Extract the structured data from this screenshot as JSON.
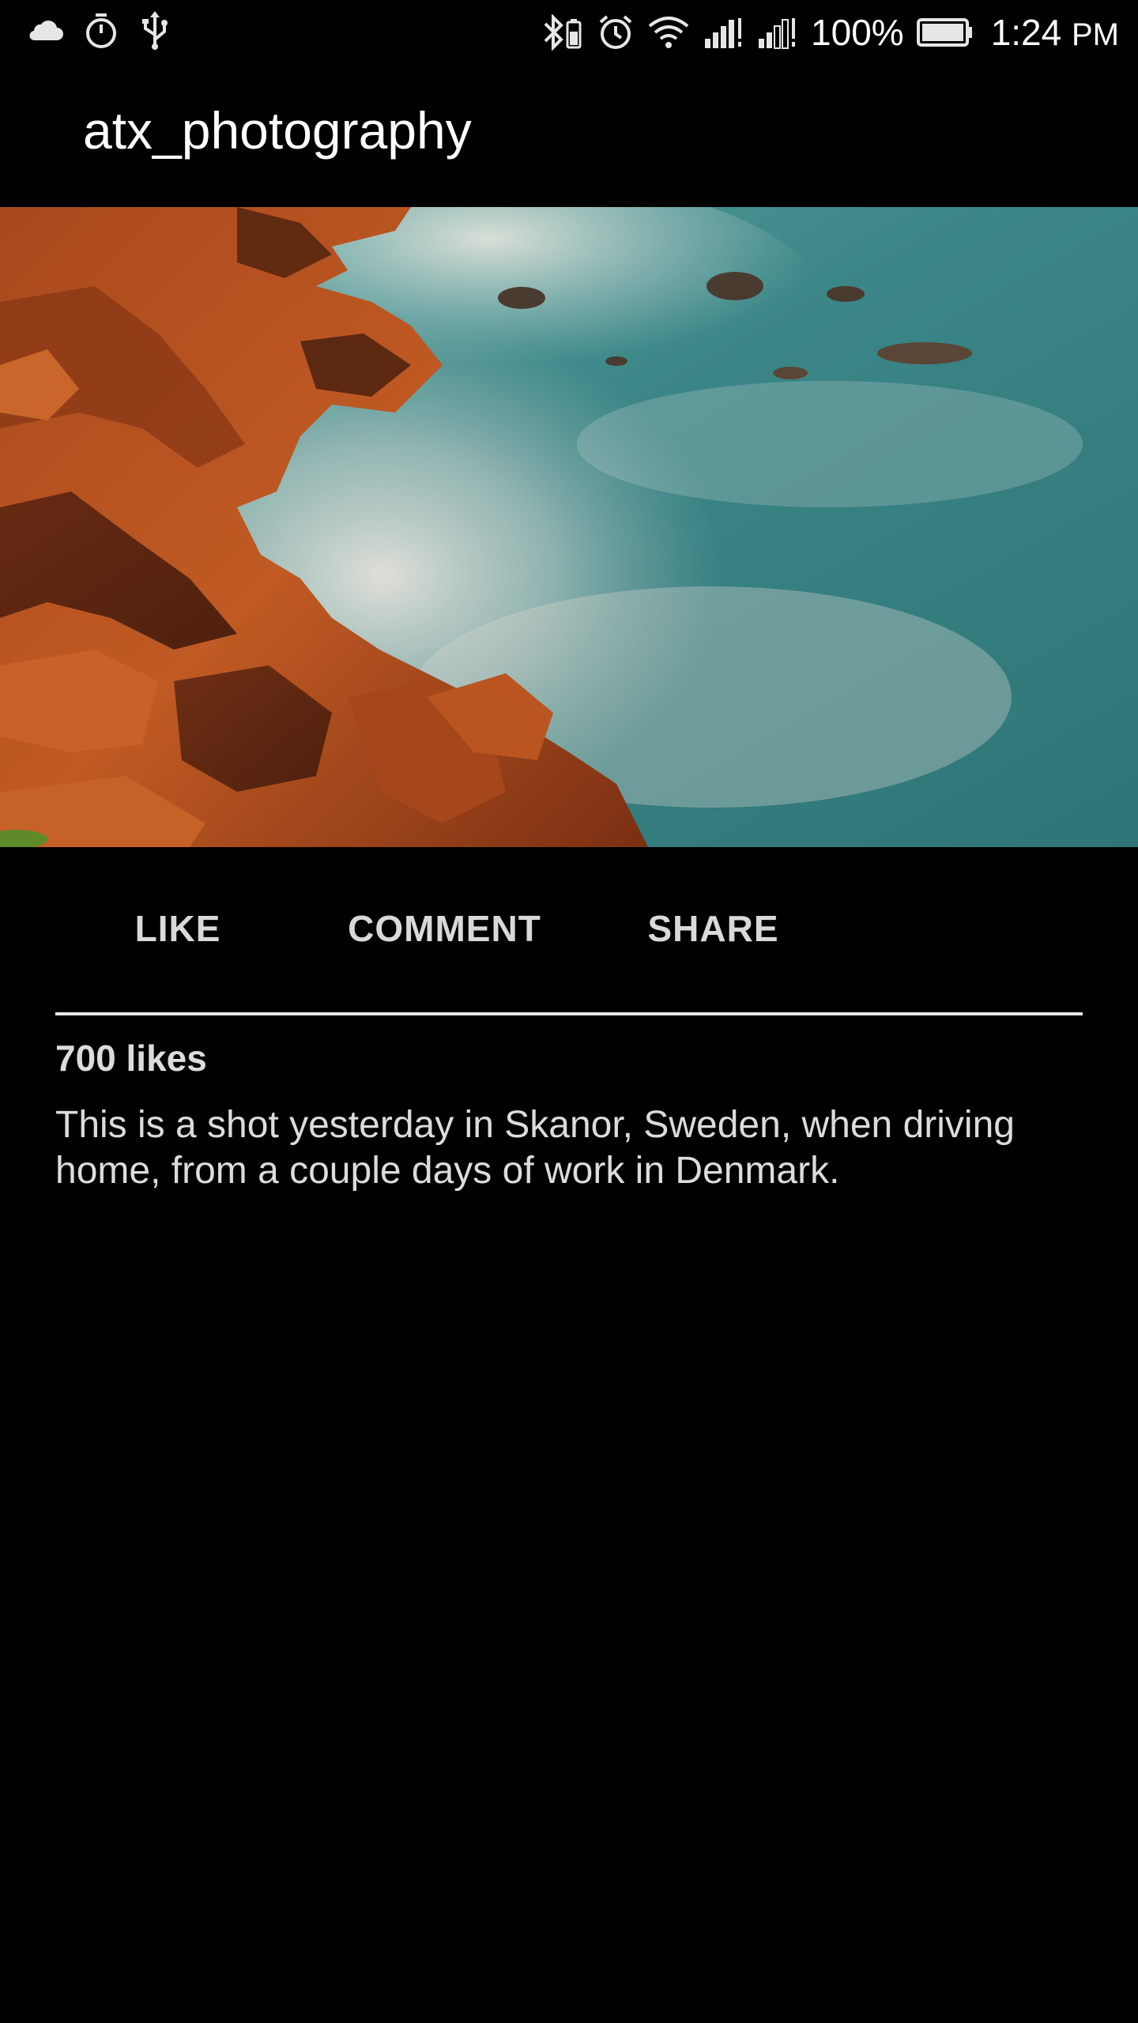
{
  "status_bar": {
    "left_icons": [
      "cloud-icon",
      "stopwatch-icon",
      "usb-icon"
    ],
    "right_icons": [
      "bluetooth-battery-icon",
      "alarm-icon",
      "wifi-icon",
      "signal-icon",
      "signal-icon-2",
      "battery-icon"
    ],
    "battery_percent": "100%",
    "time": "1:24",
    "ampm": "PM"
  },
  "app_bar": {
    "title": "atx_photography"
  },
  "post": {
    "photo_icon": "coastal-rocks-photo",
    "actions": {
      "like": "LIKE",
      "comment": "COMMENT",
      "share": "SHARE"
    },
    "likes": "700 likes",
    "caption": "This is a shot yesterday in Skanor, Sweden, when driving home, from a couple days of work in Denmark."
  },
  "colors": {
    "background": "#000000",
    "text_primary": "#ffffff",
    "text_secondary": "#dcdcdc",
    "divider": "#e8e8e8",
    "sea": "#3e8a8c",
    "rocks": "#b0501e"
  }
}
